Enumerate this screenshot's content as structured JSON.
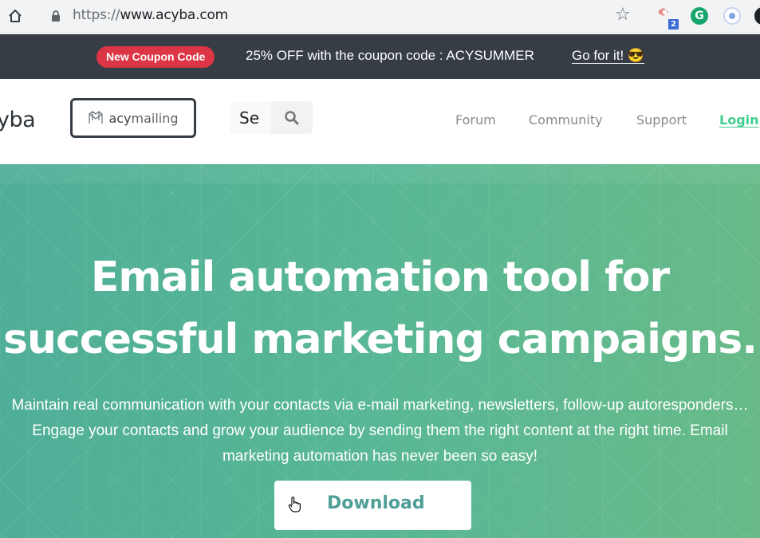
{
  "browser": {
    "url_scheme": "https://",
    "url_host": "www.acyba.com",
    "extension_badge": "2",
    "extension_grammarly": "G",
    "icons": [
      "home-icon",
      "lock-icon",
      "star-icon",
      "extension-icon",
      "grammarly-icon",
      "record-icon",
      "profile-icon"
    ]
  },
  "coupon": {
    "badge": "New Coupon Code",
    "text": "25% OFF with the coupon code : ACYSUMMER",
    "link": "Go for it! 😎"
  },
  "nav": {
    "logo_text": "yba",
    "product_prefix": "acy",
    "product_suffix": "mailing",
    "search_value": "Se",
    "links": [
      {
        "label": "Forum"
      },
      {
        "label": "Community"
      },
      {
        "label": "Support"
      },
      {
        "label": "Login"
      }
    ]
  },
  "hero": {
    "title_line1": "Email automation tool for",
    "title_line2": "successful marketing campaigns.",
    "description": "Maintain real communication with your contacts via e-mail marketing, newsletters, follow-up autoresponders… Engage your contacts and grow your audience by sending them the right content at the right time. Email marketing automation has never been so easy!",
    "cta_label": "Download"
  },
  "colors": {
    "coupon_bg": "#363d45",
    "badge_red": "#dc3545",
    "login_green": "#3fcf8e",
    "hero_start": "#4fae97",
    "hero_end": "#67ba88",
    "cta_text": "#4f9e98"
  }
}
